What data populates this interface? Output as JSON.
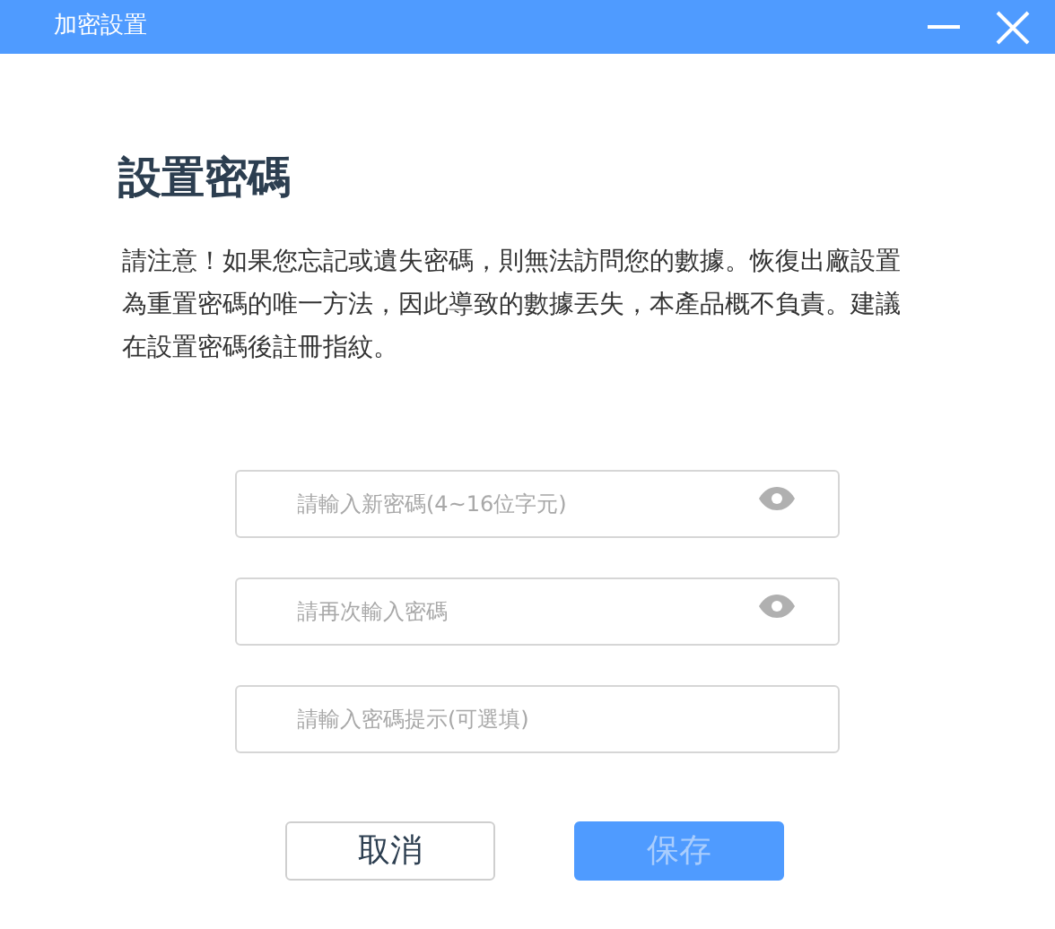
{
  "window": {
    "title": "加密設置"
  },
  "heading": "設置密碼",
  "notice": "請注意！如果您忘記或遺失密碼，則無法訪問您的數據。恢復出廠設置為重置密碼的唯一方法，因此導致的數據丟失，本產品概不負責。建議在設置密碼後註冊指紋。",
  "fields": [
    {
      "kind": "password",
      "placeholder": "請輸入新密碼(4~16位字元)"
    },
    {
      "kind": "password",
      "placeholder": "請再次輸入密碼"
    },
    {
      "kind": "text",
      "placeholder": "請輸入密碼提示(可選填)"
    }
  ],
  "buttons": [
    {
      "kind": "secondary",
      "label": "取消",
      "disabled": false
    },
    {
      "kind": "primary",
      "label": "保存",
      "disabled": true
    }
  ]
}
